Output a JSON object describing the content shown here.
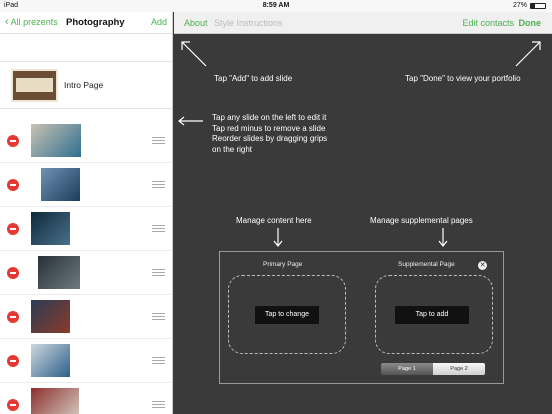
{
  "status_bar": {
    "carrier": "iPad",
    "time": "8:59 AM",
    "battery": "27%",
    "battery_fraction": 0.27
  },
  "left_nav": {
    "back_label": "All prezents",
    "title": "Photography",
    "add_label": "Add"
  },
  "intro": {
    "label": "Intro Page"
  },
  "top_nav": {
    "about": "About",
    "style_instructions": "Style Instructions",
    "edit_contacts": "Edit contacts",
    "done": "Done"
  },
  "hints": {
    "add": "Tap \"Add\" to add slide",
    "done": "Tap \"Done\" to view your portfolio",
    "edit": [
      "Tap any slide on the left to edit it",
      "Tap red minus to remove a slide",
      "Reorder slides by dragging grips",
      "on the right"
    ],
    "manage_content": "Manage content here",
    "manage_supplemental": "Manage supplemental pages"
  },
  "editor": {
    "primary_title": "Primary Page",
    "supplemental_title": "Supplemental Page",
    "tap_to_change": "Tap to change",
    "tap_to_add": "Tap to add",
    "close_glyph": "✕",
    "page_tabs": [
      "Page 1",
      "Page 2"
    ],
    "selected_tab": "Page 1"
  },
  "slides": [
    {
      "colors": [
        "#c9c2b4",
        "#2f6f8f"
      ]
    },
    {
      "colors": [
        "#6f93b3",
        "#1d3c5c"
      ]
    },
    {
      "colors": [
        "#0d2a3a",
        "#4a6f8c"
      ]
    },
    {
      "colors": [
        "#283038",
        "#6e7a80"
      ]
    },
    {
      "colors": [
        "#2a3d55",
        "#8b3a2b"
      ]
    },
    {
      "colors": [
        "#cfd7de",
        "#2c5f8a"
      ]
    },
    {
      "colors": [
        "#8c2f2f",
        "#d7d0c4"
      ]
    }
  ]
}
